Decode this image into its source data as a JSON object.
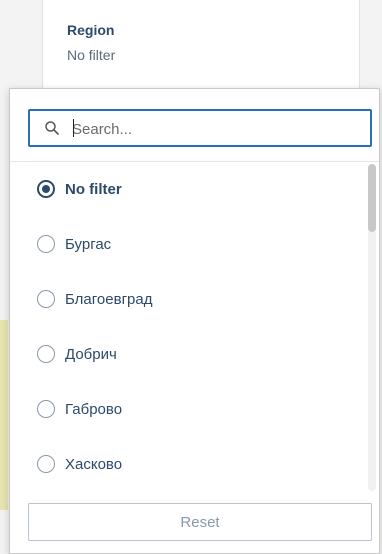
{
  "filter": {
    "title": "Region",
    "value": "No filter"
  },
  "search": {
    "placeholder": "Search..."
  },
  "options": [
    {
      "label": "No filter",
      "selected": true
    },
    {
      "label": "Бургас",
      "selected": false
    },
    {
      "label": "Благоевград",
      "selected": false
    },
    {
      "label": "Добрич",
      "selected": false
    },
    {
      "label": "Габрово",
      "selected": false
    },
    {
      "label": "Хасково",
      "selected": false
    }
  ],
  "footer": {
    "reset_label": "Reset"
  },
  "colors": {
    "accent": "#2d6fb4",
    "text": "#2c4a6b"
  }
}
